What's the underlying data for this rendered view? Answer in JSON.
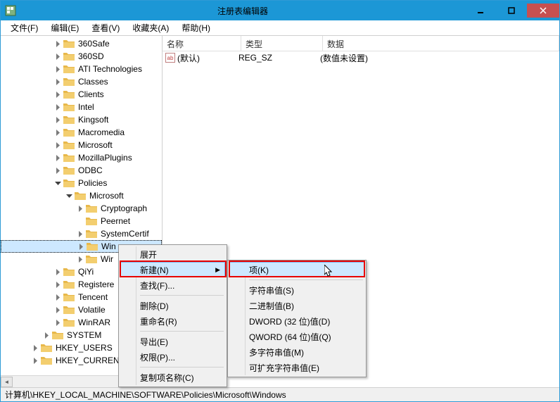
{
  "window": {
    "title": "注册表编辑器"
  },
  "menubar": [
    {
      "label": "文件(F)"
    },
    {
      "label": "编辑(E)"
    },
    {
      "label": "查看(V)"
    },
    {
      "label": "收藏夹(A)"
    },
    {
      "label": "帮助(H)"
    }
  ],
  "tree": [
    {
      "depth": 3,
      "exp": "closed",
      "label": "360Safe"
    },
    {
      "depth": 3,
      "exp": "closed",
      "label": "360SD"
    },
    {
      "depth": 3,
      "exp": "closed",
      "label": "ATI Technologies"
    },
    {
      "depth": 3,
      "exp": "closed",
      "label": "Classes"
    },
    {
      "depth": 3,
      "exp": "closed",
      "label": "Clients"
    },
    {
      "depth": 3,
      "exp": "closed",
      "label": "Intel"
    },
    {
      "depth": 3,
      "exp": "closed",
      "label": "Kingsoft"
    },
    {
      "depth": 3,
      "exp": "closed",
      "label": "Macromedia"
    },
    {
      "depth": 3,
      "exp": "closed",
      "label": "Microsoft"
    },
    {
      "depth": 3,
      "exp": "closed",
      "label": "MozillaPlugins"
    },
    {
      "depth": 3,
      "exp": "closed",
      "label": "ODBC"
    },
    {
      "depth": 3,
      "exp": "open",
      "label": "Policies"
    },
    {
      "depth": 4,
      "exp": "open",
      "label": "Microsoft"
    },
    {
      "depth": 5,
      "exp": "closed",
      "label": "Cryptograph"
    },
    {
      "depth": 5,
      "exp": "none",
      "label": "Peernet"
    },
    {
      "depth": 5,
      "exp": "closed",
      "label": "SystemCertif"
    },
    {
      "depth": 5,
      "exp": "closed",
      "label": "Win",
      "selected": true
    },
    {
      "depth": 5,
      "exp": "closed",
      "label": "Wir"
    },
    {
      "depth": 3,
      "exp": "closed",
      "label": "QiYi"
    },
    {
      "depth": 3,
      "exp": "closed",
      "label": "Registere"
    },
    {
      "depth": 3,
      "exp": "closed",
      "label": "Tencent"
    },
    {
      "depth": 3,
      "exp": "closed",
      "label": "Volatile"
    },
    {
      "depth": 3,
      "exp": "closed",
      "label": "WinRAR"
    },
    {
      "depth": 2,
      "exp": "closed",
      "label": "SYSTEM"
    },
    {
      "depth": 1,
      "exp": "closed",
      "label": "HKEY_USERS"
    },
    {
      "depth": 1,
      "exp": "closed",
      "label": "HKEY_CURRENT"
    }
  ],
  "columns": {
    "name": "名称",
    "type": "类型",
    "data": "数据"
  },
  "values": [
    {
      "name": "(默认)",
      "type": "REG_SZ",
      "data": "(数值未设置)"
    }
  ],
  "context_menu": {
    "items": [
      {
        "label": "展开"
      },
      {
        "label": "新建(N)",
        "submenu": true,
        "hover": true
      },
      {
        "label": "查找(F)..."
      },
      {
        "sep": true
      },
      {
        "label": "删除(D)"
      },
      {
        "label": "重命名(R)"
      },
      {
        "sep": true
      },
      {
        "label": "导出(E)"
      },
      {
        "label": "权限(P)..."
      },
      {
        "sep": true
      },
      {
        "label": "复制项名称(C)"
      }
    ]
  },
  "submenu": {
    "items": [
      {
        "label": "项(K)",
        "hover": true
      },
      {
        "sep": true
      },
      {
        "label": "字符串值(S)"
      },
      {
        "label": "二进制值(B)"
      },
      {
        "label": "DWORD (32 位)值(D)"
      },
      {
        "label": "QWORD (64 位)值(Q)"
      },
      {
        "label": "多字符串值(M)"
      },
      {
        "label": "可扩充字符串值(E)"
      }
    ]
  },
  "statusbar": "计算机\\HKEY_LOCAL_MACHINE\\SOFTWARE\\Policies\\Microsoft\\Windows"
}
